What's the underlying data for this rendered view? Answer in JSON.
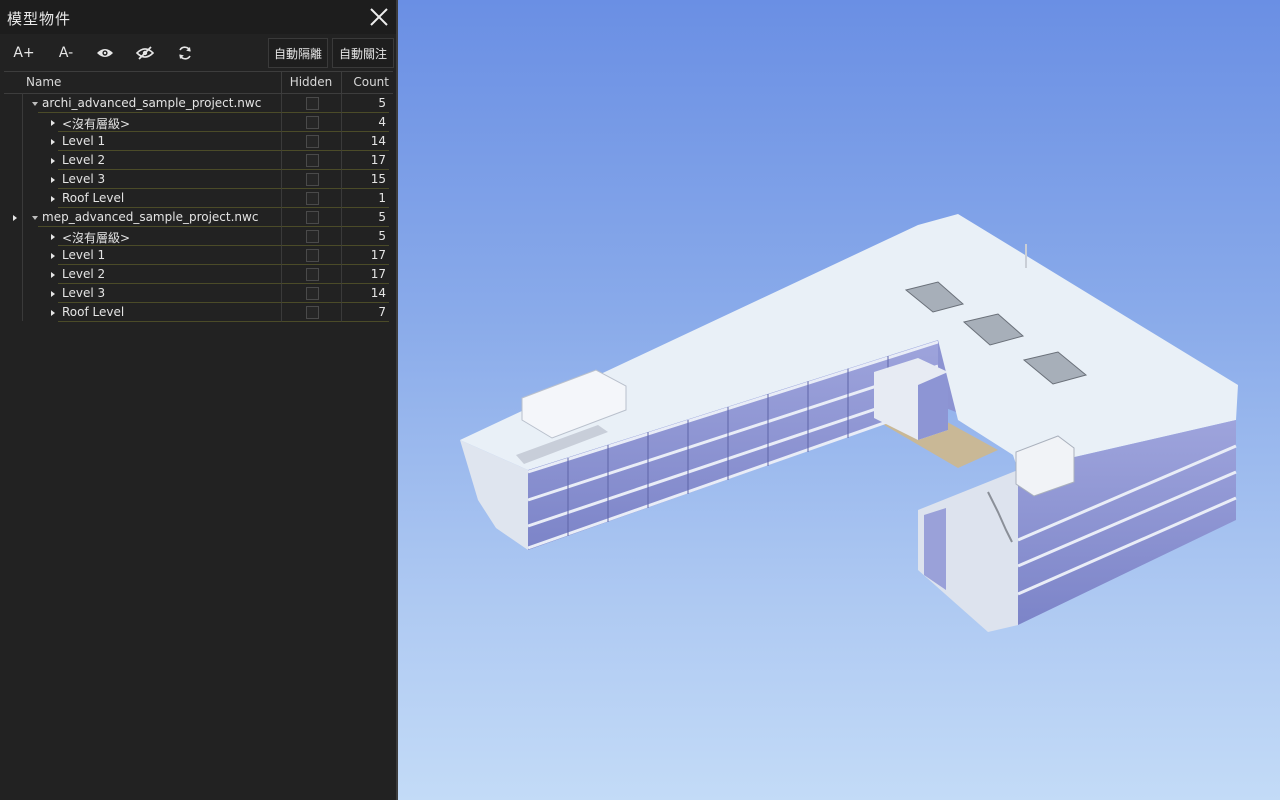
{
  "panel": {
    "title": "模型物件",
    "toolbar": {
      "font_increase": "A+",
      "font_decrease": "A-",
      "auto_isolate": "自動隔離",
      "auto_focus": "自動關注"
    },
    "columns": {
      "name": "Name",
      "hidden": "Hidden",
      "count": "Count"
    },
    "rows": [
      {
        "name": "archi_advanced_sample_project.nwc",
        "count": "5",
        "depth": 0,
        "expanded": true
      },
      {
        "name": "<沒有層級>",
        "count": "4",
        "depth": 1,
        "expanded": false
      },
      {
        "name": "Level 1",
        "count": "14",
        "depth": 1,
        "expanded": false
      },
      {
        "name": "Level 2",
        "count": "17",
        "depth": 1,
        "expanded": false
      },
      {
        "name": "Level 3",
        "count": "15",
        "depth": 1,
        "expanded": false
      },
      {
        "name": "Roof Level",
        "count": "1",
        "depth": 1,
        "expanded": false
      },
      {
        "name": "mep_advanced_sample_project.nwc",
        "count": "5",
        "depth": 0,
        "expanded": true
      },
      {
        "name": "<沒有層級>",
        "count": "5",
        "depth": 1,
        "expanded": false
      },
      {
        "name": "Level 1",
        "count": "17",
        "depth": 1,
        "expanded": false
      },
      {
        "name": "Level 2",
        "count": "17",
        "depth": 1,
        "expanded": false
      },
      {
        "name": "Level 3",
        "count": "14",
        "depth": 1,
        "expanded": false
      },
      {
        "name": "Roof Level",
        "count": "7",
        "depth": 1,
        "expanded": false
      }
    ]
  },
  "icons": [
    "close-icon",
    "eye-icon",
    "eye-slash-icon",
    "refresh-icon",
    "caret-right-icon",
    "caret-down-icon"
  ],
  "colors": {
    "panel_bg": "#222222",
    "sky_top": "#6a8fe4",
    "sky_bottom": "#c3dbf7",
    "row_border": "#4b4b28"
  }
}
